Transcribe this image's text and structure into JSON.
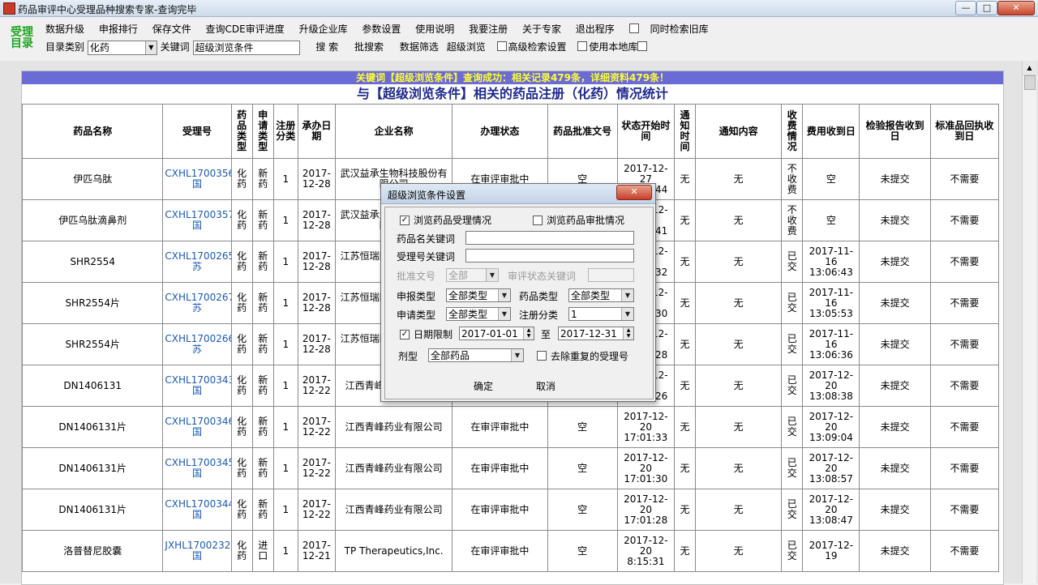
{
  "window": {
    "title": "药品审评中心受理品种搜索专家-查询完毕"
  },
  "toolbar": {
    "logo": "受理\n目录",
    "menu": [
      "数据升级",
      "申报排行",
      "保存文件",
      "查询CDE审评进度",
      "升级企业库",
      "参数设置",
      "使用说明",
      "我要注册",
      "关于专家",
      "退出程序"
    ],
    "sim_search_label": "同时检索旧库",
    "catalog_label": "目录类别",
    "catalog_value": "化药",
    "keyword_label": "关键词",
    "keyword_value": "超级浏览条件",
    "search": "搜 索",
    "batch_search": "批搜索",
    "filter": "数据筛选",
    "super_browse": "超级浏览",
    "advanced_label": "高级检索设置",
    "local_label": "使用本地库"
  },
  "banner": "关键词【超级浏览条件】查询成功：相关记录479条，详细资料479条！",
  "heading": "与【超级浏览条件】相关的药品注册（化药）情况统计",
  "table": {
    "headers": [
      "药品名称",
      "受理号",
      "药品类型",
      "申请类型",
      "注册分类",
      "承办日期",
      "企业名称",
      "办理状态",
      "药品批准文号",
      "状态开始时间",
      "通知时间",
      "通知内容",
      "收费情况",
      "费用收到日",
      "检验报告收到日",
      "标准品回执收到日"
    ],
    "rows": [
      [
        "伊匹乌肽",
        "CXHL1700356国",
        "化药",
        "新药",
        "1",
        "2017-12-28",
        "武汉益承生物科技股份有限公司",
        "在审评审批中",
        "空",
        "2017-12-27 17:01:44",
        "无",
        "无",
        "不收费",
        "空",
        "未提交",
        "不需要"
      ],
      [
        "伊匹乌肽滴鼻剂",
        "CXHL1700357国",
        "化药",
        "新药",
        "1",
        "2017-12-28",
        "武汉益承生物科技股份有限公司",
        "在审评审批中",
        "空",
        "2017-12-27 17:01:41",
        "无",
        "无",
        "不收费",
        "空",
        "未提交",
        "不需要"
      ],
      [
        "SHR2554",
        "CXHL1700265苏",
        "化药",
        "新药",
        "1",
        "2017-12-28",
        "江苏恒瑞医药股份有限公司",
        "在审评审批中",
        "空",
        "2017-12-28 09:09:32",
        "无",
        "无",
        "已交",
        "2017-11-16 13:06:43",
        "未提交",
        "不需要"
      ],
      [
        "SHR2554片",
        "CXHL1700267苏",
        "化药",
        "新药",
        "1",
        "2017-12-28",
        "江苏恒瑞医药股份有限公司",
        "在审评审批中",
        "空",
        "2017-12-28 09:09:30",
        "无",
        "无",
        "已交",
        "2017-11-16 13:05:53",
        "未提交",
        "不需要"
      ],
      [
        "SHR2554片",
        "CXHL1700266苏",
        "化药",
        "新药",
        "1",
        "2017-12-28",
        "江苏恒瑞医药股份有限公司",
        "在审评审批中",
        "空",
        "2017-12-28 09:09:28",
        "无",
        "无",
        "已交",
        "2017-11-16 13:06:36",
        "未提交",
        "不需要"
      ],
      [
        "DN1406131",
        "CXHL1700343国",
        "化药",
        "新药",
        "1",
        "2017-12-22",
        "江西青峰药业有限公司",
        "在审评审批中",
        "空",
        "2017-12-20 17:01:26",
        "无",
        "无",
        "已交",
        "2017-12-20 13:08:38",
        "未提交",
        "不需要"
      ],
      [
        "DN1406131片",
        "CXHL1700346国",
        "化药",
        "新药",
        "1",
        "2017-12-22",
        "江西青峰药业有限公司",
        "在审评审批中",
        "空",
        "2017-12-20 17:01:33",
        "无",
        "无",
        "已交",
        "2017-12-20 13:09:04",
        "未提交",
        "不需要"
      ],
      [
        "DN1406131片",
        "CXHL1700345国",
        "化药",
        "新药",
        "1",
        "2017-12-22",
        "江西青峰药业有限公司",
        "在审评审批中",
        "空",
        "2017-12-20 17:01:30",
        "无",
        "无",
        "已交",
        "2017-12-20 13:08:57",
        "未提交",
        "不需要"
      ],
      [
        "DN1406131片",
        "CXHL1700344国",
        "化药",
        "新药",
        "1",
        "2017-12-22",
        "江西青峰药业有限公司",
        "在审评审批中",
        "空",
        "2017-12-20 17:01:28",
        "无",
        "无",
        "已交",
        "2017-12-20 13:08:47",
        "未提交",
        "不需要"
      ],
      [
        "洛普替尼胶囊",
        "JXHL1700232国",
        "化药",
        "进口",
        "1",
        "2017-12-21",
        "TP Therapeutics,Inc.",
        "在审评审批中",
        "空",
        "2017-12-20 8:15:31",
        "无",
        "无",
        "已交",
        "2017-12-19",
        "未提交",
        "不需要"
      ]
    ]
  },
  "dialog": {
    "title": "超级浏览条件设置",
    "browse_accept": "浏览药品受理情况",
    "browse_approve": "浏览药品审批情况",
    "name_kw": "药品名关键词",
    "accept_kw": "受理号关键词",
    "approval_no": "批准文号",
    "approval_value": "全部",
    "review_kw": "审评状态关键词",
    "apply_type": "申报类型",
    "apply_type_value": "全部类型",
    "drug_type": "药品类型",
    "drug_type_value": "全部类型",
    "request_type": "申请类型",
    "request_type_value": "全部类型",
    "reg_class": "注册分类",
    "reg_class_value": "1",
    "date_limit": "日期限制",
    "date_from": "2017-01-01",
    "date_to_label": "至",
    "date_to": "2017-12-31",
    "form": "剂型",
    "form_value": "全部药品",
    "dedupe": "去除重复的受理号",
    "ok": "确定",
    "cancel": "取消"
  }
}
